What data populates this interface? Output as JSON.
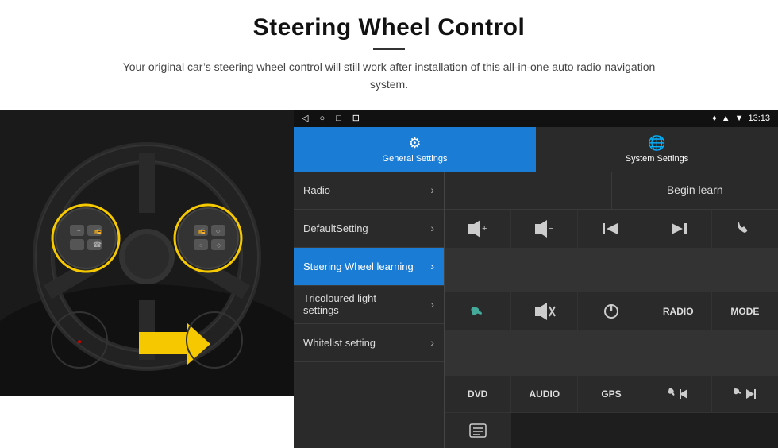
{
  "page": {
    "title": "Steering Wheel Control",
    "subtitle": "Your original car’s steering wheel control will still work after installation of this all-in-one auto radio navigation system."
  },
  "status_bar": {
    "nav_icons": [
      "◁",
      "○",
      "□",
      "⊡"
    ],
    "right_text": "13:13",
    "signal_icon": "▲",
    "wifi_icon": "▼"
  },
  "tabs": [
    {
      "label": "General Settings",
      "icon": "⚙",
      "active": true
    },
    {
      "label": "System Settings",
      "icon": "🌐",
      "active": false
    }
  ],
  "menu_items": [
    {
      "label": "Radio",
      "active": false
    },
    {
      "label": "DefaultSetting",
      "active": false
    },
    {
      "label": "Steering Wheel learning",
      "active": true
    },
    {
      "label": "Tricoloured light settings",
      "active": false
    },
    {
      "label": "Whitelist setting",
      "active": false
    }
  ],
  "begin_learn_label": "Begin learn",
  "control_buttons": {
    "row1": [
      {
        "icon": "🔊+",
        "type": "icon"
      },
      {
        "icon": "🔊-",
        "type": "icon"
      },
      {
        "icon": "⏮",
        "type": "icon"
      },
      {
        "icon": "⏭",
        "type": "icon"
      },
      {
        "icon": "📞",
        "type": "icon"
      }
    ],
    "row2": [
      {
        "icon": "📞",
        "type": "answer"
      },
      {
        "icon": "🔇",
        "type": "mute"
      },
      {
        "icon": "⏻",
        "type": "power"
      },
      {
        "text": "RADIO",
        "type": "text"
      },
      {
        "text": "MODE",
        "type": "text"
      }
    ],
    "row3": [
      {
        "text": "DVD",
        "type": "text"
      },
      {
        "text": "AUDIO",
        "type": "text"
      },
      {
        "text": "GPS",
        "type": "text"
      },
      {
        "icon": "📞⏮",
        "type": "icon"
      },
      {
        "icon": "⏭📞",
        "type": "icon"
      }
    ]
  },
  "last_row_icon": "📋"
}
